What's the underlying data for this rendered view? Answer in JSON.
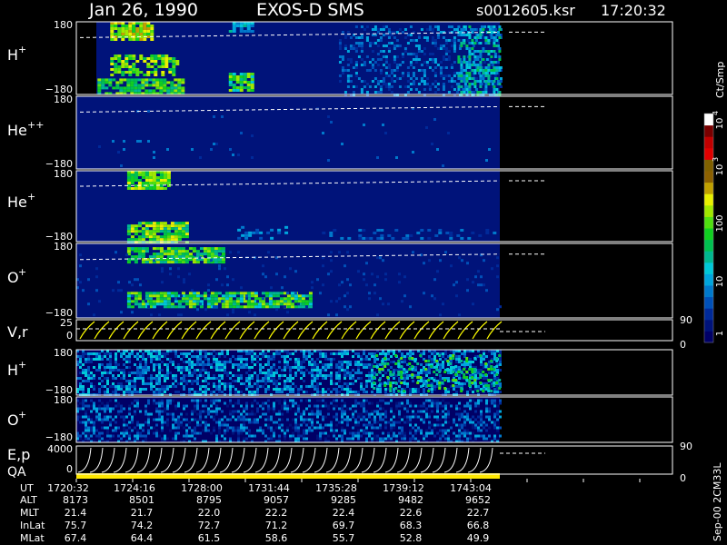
{
  "header": {
    "date": "Jan 26, 1990",
    "instrument": "EXOS-D SMS",
    "file": "s0012605.ksr",
    "time": "17:20:32"
  },
  "chart_data": {
    "type": "heatmap",
    "panels": [
      {
        "id": "h_plus",
        "label": "H",
        "sup": "+",
        "ymax": "180",
        "ymin": "−180"
      },
      {
        "id": "he_pp",
        "label": "He",
        "sup": "++",
        "ymax": "180",
        "ymin": "−180"
      },
      {
        "id": "he_plus",
        "label": "He",
        "sup": "+",
        "ymax": "180",
        "ymin": "−180"
      },
      {
        "id": "o_plus",
        "label": "O",
        "sup": "+",
        "ymax": "180",
        "ymin": "−180"
      },
      {
        "id": "vr",
        "label": "V,r",
        "sup": "",
        "ymax": "25",
        "ymin": "0",
        "right_top": "90",
        "right_bottom": "0"
      },
      {
        "id": "h_plus_2",
        "label": "H",
        "sup": "+",
        "ymax": "180",
        "ymin": "−180"
      },
      {
        "id": "o_plus_2",
        "label": "O",
        "sup": "+",
        "ymax": "180",
        "ymin": "−180"
      },
      {
        "id": "ep",
        "label": "E,p",
        "sup": "",
        "label2": "QA",
        "ymax": "4000",
        "ymin": "0",
        "right_top": "90",
        "right_bottom": "0"
      }
    ],
    "colorbar": {
      "title": "Ct/Smp",
      "ticks": [
        {
          "base": "10",
          "exp": "4"
        },
        {
          "base": "10",
          "exp": "3"
        },
        {
          "base": "100",
          "exp": ""
        },
        {
          "base": "10",
          "exp": ""
        },
        {
          "base": "1",
          "exp": ""
        }
      ],
      "colors": [
        "#000066",
        "#00137a",
        "#002a99",
        "#0050b8",
        "#0079cc",
        "#00a5dd",
        "#00c8d8",
        "#00b890",
        "#00c050",
        "#10d020",
        "#50e010",
        "#a0e800",
        "#e8f000",
        "#c0a000",
        "#8c6000",
        "#806000",
        "#e00000",
        "#c00000",
        "#7a0000",
        "#ffffff"
      ]
    },
    "time_axis": {
      "ticks": [
        "1720:32",
        "1724:16",
        "1728:00",
        "1731:44",
        "1735:28",
        "1739:12",
        "1743:04"
      ],
      "rows": [
        {
          "name": "UT",
          "values": [
            "1720:32",
            "1724:16",
            "1728:00",
            "1731:44",
            "1735:28",
            "1739:12",
            "1743:04"
          ]
        },
        {
          "name": "ALT",
          "values": [
            "8173",
            "8501",
            "8795",
            "9057",
            "9285",
            "9482",
            "9652"
          ]
        },
        {
          "name": "MLT",
          "values": [
            "21.4",
            "21.7",
            "22.0",
            "22.2",
            "22.4",
            "22.6",
            "22.7"
          ]
        },
        {
          "name": "InLat",
          "values": [
            "75.7",
            "74.2",
            "72.7",
            "71.2",
            "69.7",
            "68.3",
            "66.8"
          ]
        },
        {
          "name": "MLat",
          "values": [
            "67.4",
            "64.4",
            "61.5",
            "58.6",
            "55.7",
            "52.8",
            "49.9"
          ]
        }
      ]
    }
  },
  "footer": {
    "code": "Sep-00 2CM33L"
  }
}
